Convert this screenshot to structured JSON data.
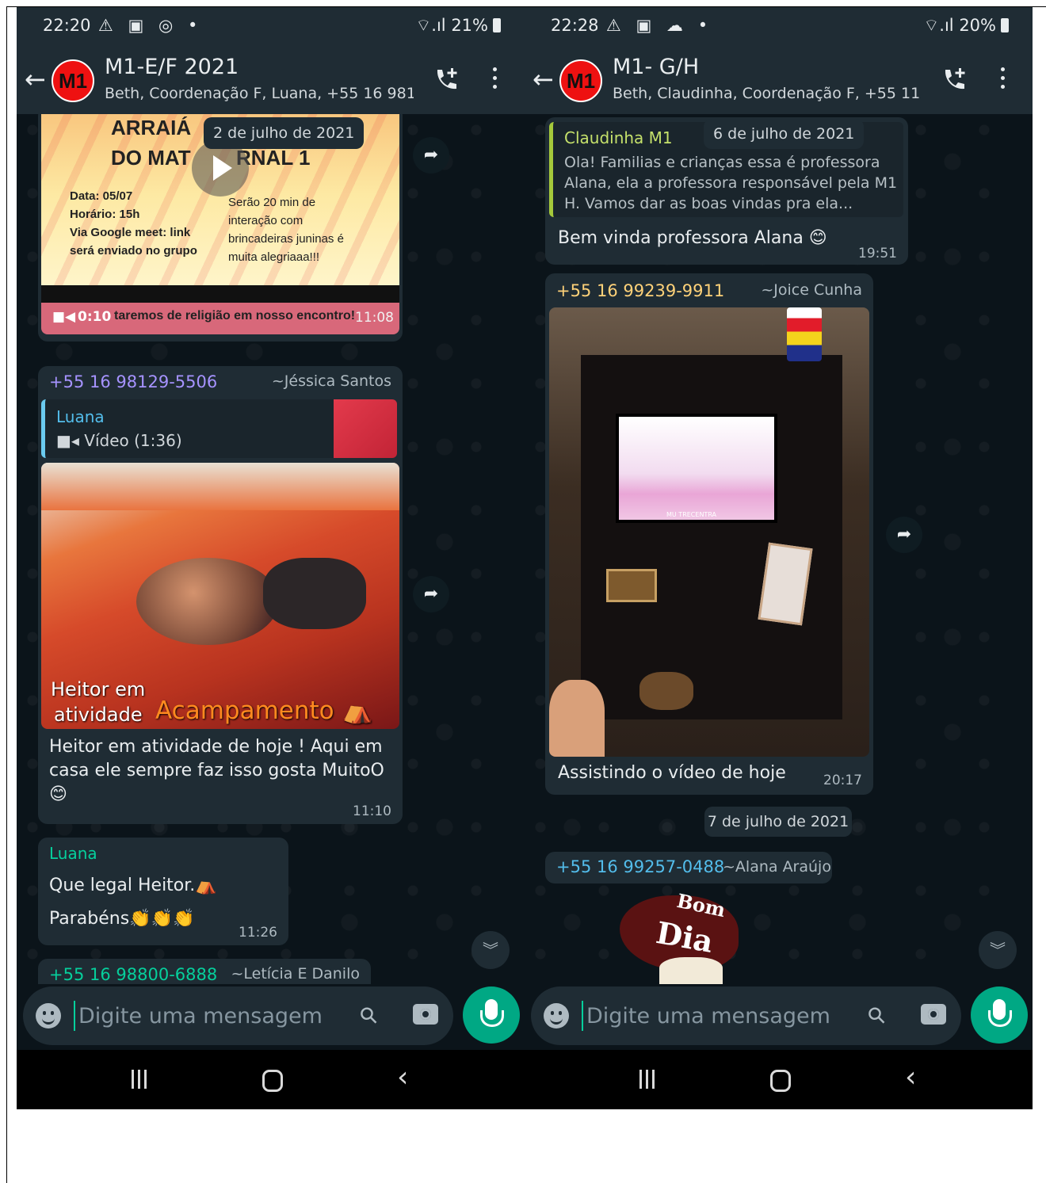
{
  "left": {
    "status": {
      "time": "22:20",
      "icons": "⚠ ▣ ◎ •",
      "signal": "⌔.ıl",
      "battery": "21%"
    },
    "header": {
      "avatar": "M1",
      "title": "M1-E/F  2021",
      "subtitle": "Beth, Coordenação F, Luana, +55 16 981..."
    },
    "video": {
      "date_pill": "2 de julho de 2021",
      "poster_title_1": "ARRAIÁ",
      "poster_title_2": "DO MAT",
      "poster_title_2b": "RNAL 1",
      "poster_left": [
        "Data: 05/07",
        "Horário: 15h",
        "Via Google meet: link",
        "será enviado no grupo"
      ],
      "poster_right": [
        "Serão 20 min de",
        "interação com",
        "brincadeiras juninas é",
        "muita alegriaaa!!!"
      ],
      "duration": "0:10",
      "caption": "taremos de religião em nosso encontro!",
      "time": "11:08"
    },
    "msg2": {
      "phone": "+55 16 98129-5506",
      "name": "~Jéssica Santos",
      "quote_name": "Luana",
      "quote_text": "Vídeo (1:36)",
      "photo_caption_1": "Heitor em",
      "photo_caption_2": "atividade",
      "photo_caption_3": "Acampamento ⛺",
      "text": "Heitor em atividade de hoje ! Aqui em casa ele sempre faz isso gosta MuitoO 😊",
      "time": "11:10"
    },
    "msg3": {
      "name": "Luana",
      "line1": "Que legal Heitor.⛺",
      "line2": "Parabéns👏👏👏",
      "time": "11:26"
    },
    "msg4": {
      "phone": "+55 16 98800-6888",
      "name": "~Letícia E Danilo"
    },
    "composer": {
      "placeholder": "Digite uma mensagem"
    }
  },
  "right": {
    "status": {
      "time": "22:28",
      "icons": "⚠ ▣ ☁ •",
      "signal": "⌔.ıl",
      "battery": "20%"
    },
    "header": {
      "avatar": "M1",
      "title": "M1- G/H",
      "subtitle": "Beth, Claudinha, Coordenação F, +55 11 ..."
    },
    "msg1": {
      "quote_name": "Claudinha M1",
      "date_pill": "6 de julho de 2021",
      "quote_text": "Ola! Familias e crianças essa é professora Alana, ela a professora responsável pela M1 H. Vamos dar as boas vindas pra ela...",
      "text": "Bem vinda professora Alana 😊",
      "time": "19:51"
    },
    "msg2": {
      "phone": "+55 16 99239-9911",
      "name": "~Joice Cunha",
      "tv_label": "MU  TRECENTRA",
      "text": "Assistindo o vídeo de hoje",
      "time": "20:17"
    },
    "date_pill_2": "7 de julho de 2021",
    "msg3": {
      "phone": "+55 16 99257-0488",
      "name": "~Alana Araújo",
      "sticker_1": "Bom",
      "sticker_2": "Dia"
    },
    "composer": {
      "placeholder": "Digite uma mensagem"
    }
  },
  "colors": {
    "chat_bg": "#0b141a",
    "bar_bg": "#1f2c34",
    "bubble": "#1f2c34",
    "accent": "#00a884",
    "phone_color_left": "#a693ff",
    "phone_color_right": "#ffd279",
    "quote_name_green": "#53bdeb"
  },
  "icons": [
    "back-arrow-icon",
    "call-add-icon",
    "more-vert-icon",
    "forward-icon",
    "chevron-down-icon",
    "emoji-icon",
    "attach-icon",
    "camera-icon",
    "mic-icon"
  ]
}
